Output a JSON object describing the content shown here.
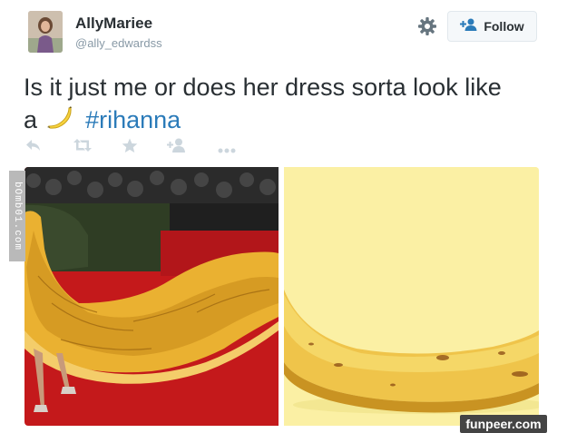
{
  "header": {
    "display_name": "AllyMariee",
    "handle": "@ally_edwardss",
    "follow_label": "Follow",
    "avatar_icon": "user-avatar",
    "settings_icon": "gear-icon"
  },
  "tweet": {
    "text_before": "Is it just me or does her dress sorta look like",
    "text_word": "a",
    "emoji": "banana-emoji",
    "hashtag": "#rihanna"
  },
  "actions": [
    {
      "name": "reply",
      "icon": "reply-icon"
    },
    {
      "name": "retweet",
      "icon": "retweet-icon"
    },
    {
      "name": "favorite",
      "icon": "star-icon"
    },
    {
      "name": "follow",
      "icon": "add-user-icon"
    },
    {
      "name": "more",
      "icon": "more-icon"
    }
  ],
  "media": {
    "left_photo": "red-carpet-yellow-gown-photo",
    "right_photo": "banana-photo"
  },
  "watermarks": {
    "side": "bOmb01.com",
    "bottom": "funpeer.com"
  },
  "colors": {
    "hashtag": "#2b7bb9",
    "name": "#292f33",
    "handle": "#8899a6",
    "action_icon": "#ccd6dd",
    "follow_icon": "#2b7bb9"
  }
}
